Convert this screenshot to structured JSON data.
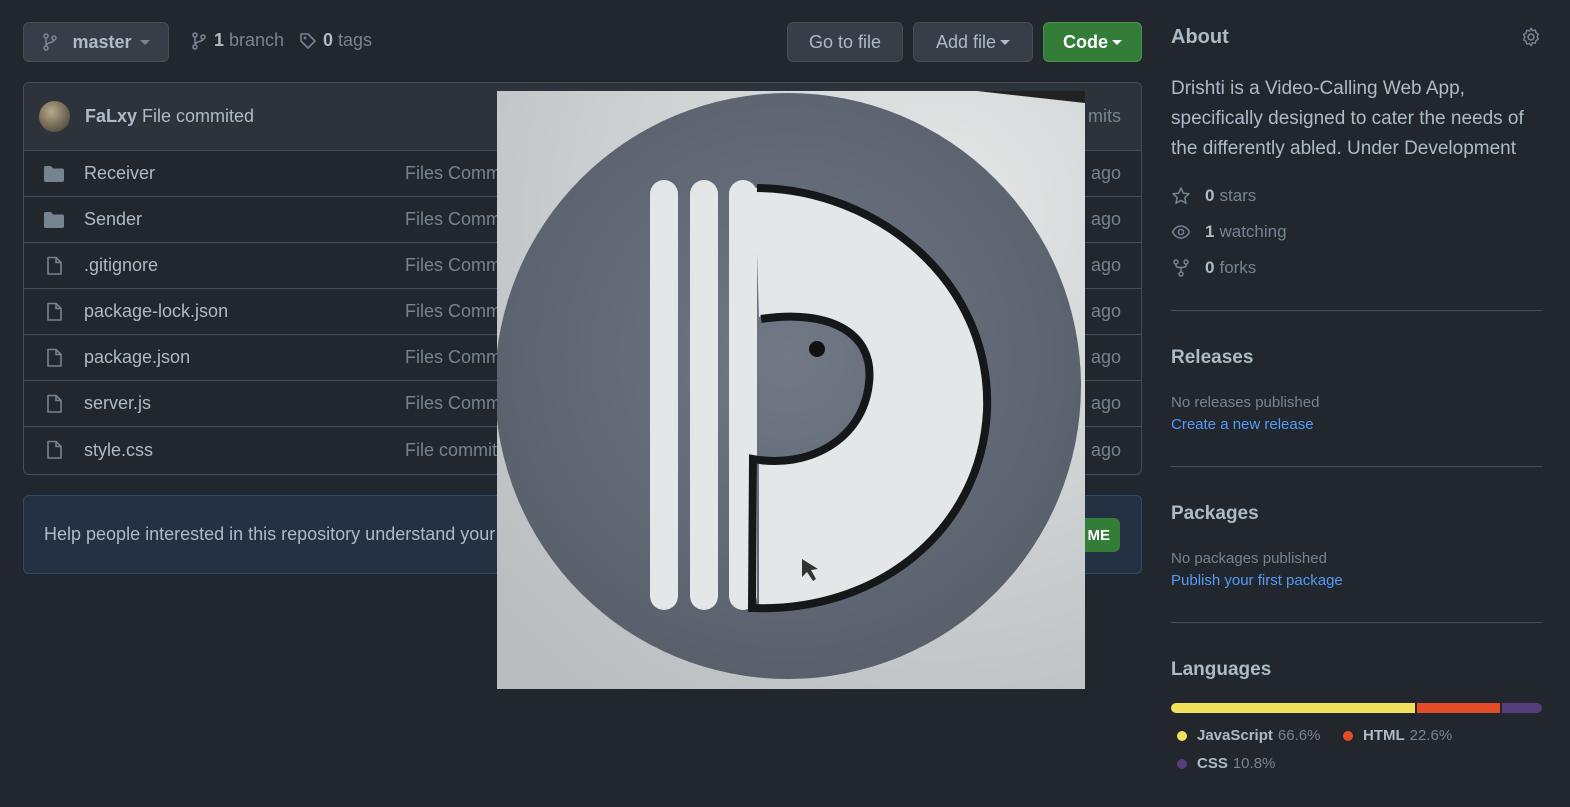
{
  "toolbar": {
    "branch": "master",
    "branches_count": "1",
    "branches_label": "branch",
    "tags_count": "0",
    "tags_label": "tags",
    "go_to_file": "Go to file",
    "add_file": "Add file",
    "code": "Code"
  },
  "commit": {
    "author": "FaLxy",
    "message": "File commited",
    "count_fragment": "mits"
  },
  "files": [
    {
      "name": "Receiver",
      "type": "folder",
      "message": "Files Commi",
      "age": "ago"
    },
    {
      "name": "Sender",
      "type": "folder",
      "message": "Files Commi",
      "age": "ago"
    },
    {
      "name": ".gitignore",
      "type": "file",
      "message": "Files Commi",
      "age": "ago"
    },
    {
      "name": "package-lock.json",
      "type": "file",
      "message": "Files Commi",
      "age": "ago"
    },
    {
      "name": "package.json",
      "type": "file",
      "message": "Files Commi",
      "age": "ago"
    },
    {
      "name": "server.js",
      "type": "file",
      "message": "Files Commi",
      "age": "ago"
    },
    {
      "name": "style.css",
      "type": "file",
      "message": "File commite",
      "age": "ago"
    }
  ],
  "readme": {
    "text": "Help people interested in this repository understand your p",
    "button": "ME"
  },
  "overlay": {
    "icon": "drishti-logo-photo"
  },
  "about": {
    "title": "About",
    "description": "Drishti is a Video-Calling Web App, specifically designed to cater the needs of the differently abled. Under Development",
    "stars_count": "0",
    "stars_label": "stars",
    "watching_count": "1",
    "watching_label": "watching",
    "forks_count": "0",
    "forks_label": "forks"
  },
  "releases": {
    "title": "Releases",
    "text": "No releases published",
    "link": "Create a new release"
  },
  "packages": {
    "title": "Packages",
    "text": "No packages published",
    "link": "Publish your first package"
  },
  "languages": {
    "title": "Languages",
    "items": [
      {
        "name": "JavaScript",
        "percent": "66.6%",
        "value": 66.6,
        "color": "#f1e05a"
      },
      {
        "name": "HTML",
        "percent": "22.6%",
        "value": 22.6,
        "color": "#e34c26"
      },
      {
        "name": "CSS",
        "percent": "10.8%",
        "value": 10.8,
        "color": "#563d7c"
      }
    ]
  },
  "colors": {
    "background": "#22272e",
    "accent_green": "#347d39",
    "link_blue": "#539bf5"
  }
}
